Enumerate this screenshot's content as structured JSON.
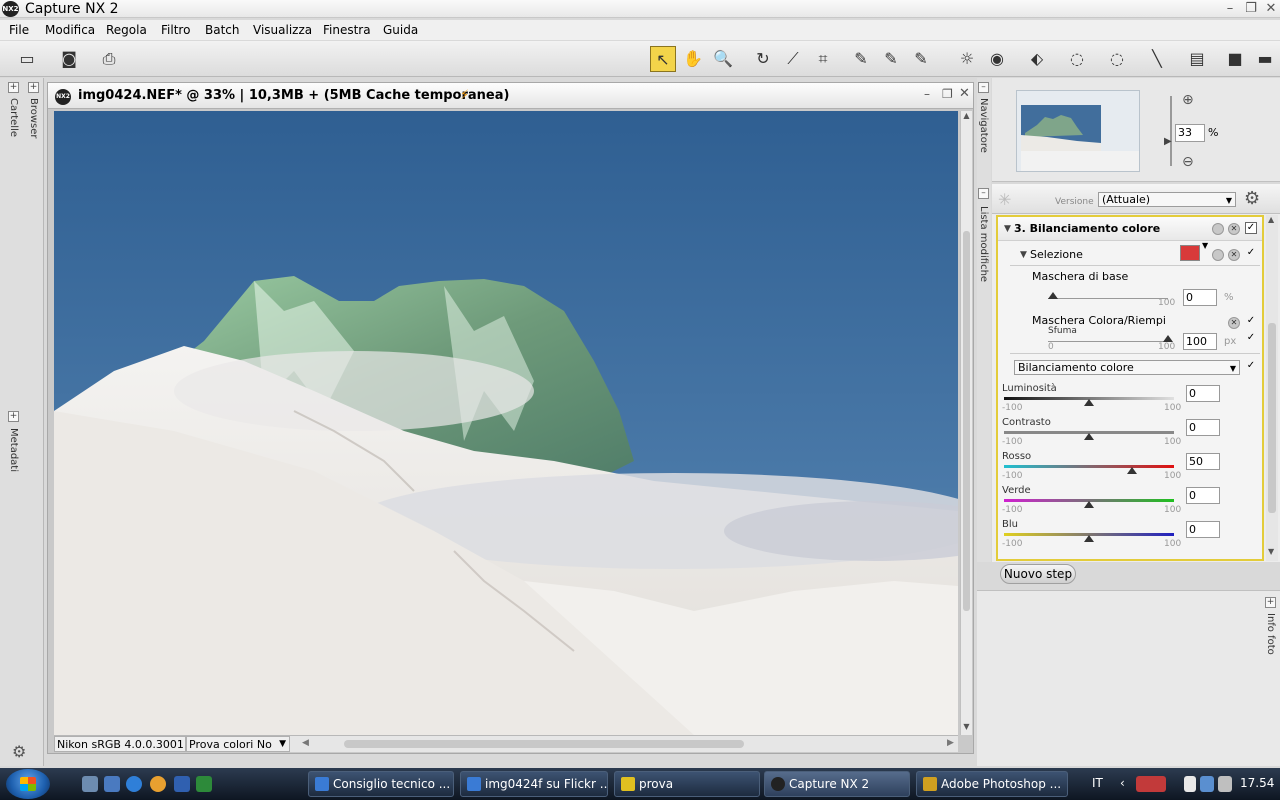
{
  "window": {
    "app_logo": "NX2",
    "title": "Capture NX 2",
    "minimize": "–",
    "restore": "❐",
    "close": "✕"
  },
  "menu": [
    "File",
    "Modifica",
    "Regola",
    "Filtro",
    "Batch",
    "Visualizza",
    "Finestra",
    "Guida"
  ],
  "left_panels": {
    "cartelle": "Cartelle",
    "browser": "Browser",
    "metadati": "Metadati"
  },
  "document": {
    "title": "img0424.NEF* @ 33% | 10,3MB + (5MB Cache temporanea)",
    "logo": "NX2",
    "status_icon": "⚡",
    "color_profile": "Nikon sRGB 4.0.0.3001",
    "proof_colors": "Prova colori No"
  },
  "navigator": {
    "tab": "Navigatore",
    "zoom": "33",
    "unit": "%"
  },
  "edit_list": {
    "tab": "Lista modifiche",
    "version_label": "Versione",
    "version_value": "(Attuale)",
    "step_title": "3. Bilanciamento colore",
    "selection_label": "Selezione",
    "base_mask": {
      "label": "Maschera di base",
      "max_label": "100",
      "value": "0",
      "unit": "%",
      "level": 0
    },
    "color_mask": {
      "label": "Maschera Colora/Riempi",
      "sub_label": "Sfuma",
      "min_label": "0",
      "max_label": "100",
      "value": "100",
      "unit": "px",
      "level": 100
    },
    "adjustment_dropdown": "Bilanciamento colore",
    "sliders": [
      {
        "label": "Luminosità",
        "min": "-100",
        "max": "100",
        "value": "0",
        "level": 0,
        "track": "#111111,#e0e0e0"
      },
      {
        "label": "Contrasto",
        "min": "-100",
        "max": "100",
        "value": "0",
        "level": 0,
        "track": "#888888,#888888"
      },
      {
        "label": "Rosso",
        "min": "-100",
        "max": "100",
        "value": "50",
        "level": 50,
        "track": "#20c0d0,#e01010"
      },
      {
        "label": "Verde",
        "min": "-100",
        "max": "100",
        "value": "0",
        "level": 0,
        "track": "#d020d0,#20c020"
      },
      {
        "label": "Blu",
        "min": "-100",
        "max": "100",
        "value": "0",
        "level": 0,
        "track": "#e0d020,#2020c0"
      }
    ],
    "new_step_button": "Nuovo step"
  },
  "info_tab": "Info foto",
  "taskbar": {
    "tasks": [
      {
        "label": "Consiglio tecnico ...",
        "icon_color": "#3a7bd5"
      },
      {
        "label": "img0424f su Flickr ...",
        "icon_color": "#3a7bd5"
      },
      {
        "label": "prova",
        "icon_color": "#e0c020"
      },
      {
        "label": "Capture NX 2",
        "icon_color": "#222222"
      },
      {
        "label": "Adobe Photoshop ...",
        "icon_color": "#d0a020"
      }
    ],
    "language": "IT",
    "clock": "17.54"
  }
}
